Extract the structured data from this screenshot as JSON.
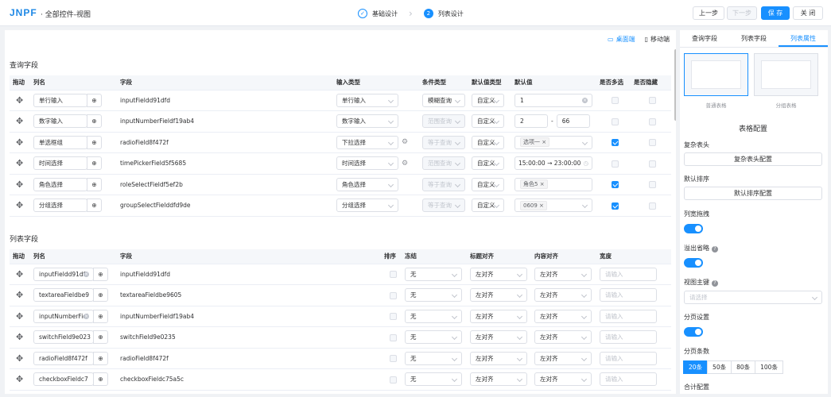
{
  "header": {
    "logo": "JNPF",
    "title": "全部控件-视图",
    "steps": [
      {
        "num": "✓",
        "label": "基础设计",
        "state": "done"
      },
      {
        "num": "2",
        "label": "列表设计",
        "state": "active"
      }
    ],
    "buttons": {
      "prev": "上一步",
      "next": "下一步",
      "save": "保 存",
      "close": "关 闭"
    }
  },
  "device": {
    "desktop": "桌面端",
    "mobile": "移动端"
  },
  "query": {
    "title": "查询字段",
    "headers": [
      "拖动",
      "列名",
      "字段",
      "输入类型",
      "条件类型",
      "默认值类型",
      "默认值",
      "是否多选",
      "是否隐藏"
    ],
    "rows": [
      {
        "name": "单行输入",
        "field": "inputFieldd91dfd",
        "input_type": "单行输入",
        "cond": "模糊查询",
        "default_type": "自定义",
        "default": "1"
      },
      {
        "name": "数字输入",
        "field": "inputNumberFieldf19ab4",
        "input_type": "数字输入",
        "cond": "范围查询",
        "default_type": "自定义",
        "range_from": "2",
        "range_sep": "-",
        "range_to": "66"
      },
      {
        "name": "单选框组",
        "field": "radioField8f472f",
        "input_type": "下拉选择",
        "cond": "等于查询",
        "default_type": "自定义",
        "tag": "选项一"
      },
      {
        "name": "时间选择",
        "field": "timePickerField5f5685",
        "input_type": "时间选择",
        "cond": "范围查询",
        "default_type": "自定义",
        "time_from": "15:00:00",
        "time_sep": "→",
        "time_to": "23:00:00"
      },
      {
        "name": "角色选择",
        "field": "roleSelectFieldf5ef2b",
        "input_type": "角色选择",
        "cond": "等于查询",
        "default_type": "自定义",
        "tag": "角色5"
      },
      {
        "name": "分组选择",
        "field": "groupSelectFielddfd9de",
        "input_type": "分组选择",
        "cond": "等于查询",
        "default_type": "自定义",
        "tag": "0609"
      }
    ]
  },
  "list": {
    "title": "列表字段",
    "headers": [
      "拖动",
      "列名",
      "字段",
      "排序",
      "冻结",
      "标题对齐",
      "内容对齐",
      "宽度"
    ],
    "rows": [
      {
        "name": "inputFieldd91dfc",
        "field": "inputFieldd91dfd",
        "freeze": "无",
        "title_align": "左对齐",
        "content_align": "左对齐",
        "width_placeholder": "请输入"
      },
      {
        "name": "textareaFieldbe9",
        "field": "textareaFieldbe9605",
        "freeze": "无",
        "title_align": "左对齐",
        "content_align": "左对齐",
        "width_placeholder": "请输入"
      },
      {
        "name": "inputNumberFiel",
        "field": "inputNumberFieldf19ab4",
        "freeze": "无",
        "title_align": "左对齐",
        "content_align": "左对齐",
        "width_placeholder": "请输入"
      },
      {
        "name": "switchField9e023",
        "field": "switchField9e0235",
        "freeze": "无",
        "title_align": "左对齐",
        "content_align": "左对齐",
        "width_placeholder": "请输入"
      },
      {
        "name": "radioField8f472f",
        "field": "radioField8f472f",
        "freeze": "无",
        "title_align": "左对齐",
        "content_align": "左对齐",
        "width_placeholder": "请输入"
      },
      {
        "name": "checkboxFieldc7",
        "field": "checkboxFieldc75a5c",
        "freeze": "无",
        "title_align": "左对齐",
        "content_align": "左对齐",
        "width_placeholder": "请输入"
      }
    ]
  },
  "side": {
    "tabs": [
      "查询字段",
      "列表字段",
      "列表属性"
    ],
    "thumbs": [
      "普通表格",
      "分组表格"
    ],
    "table_config": "表格配置",
    "complex_header": "复杂表头",
    "complex_header_btn": "复杂表头配置",
    "default_sort": "默认排序",
    "default_sort_btn": "默认排序配置",
    "col_drag": "列宽拖拽",
    "overflow": "溢出省略",
    "view_key": "视图主键",
    "view_key_placeholder": "请选择",
    "paging": "分页设置",
    "page_size": "分页条数",
    "page_sizes": [
      "20条",
      "50条",
      "80条",
      "100条"
    ],
    "summary": "合计配置"
  }
}
